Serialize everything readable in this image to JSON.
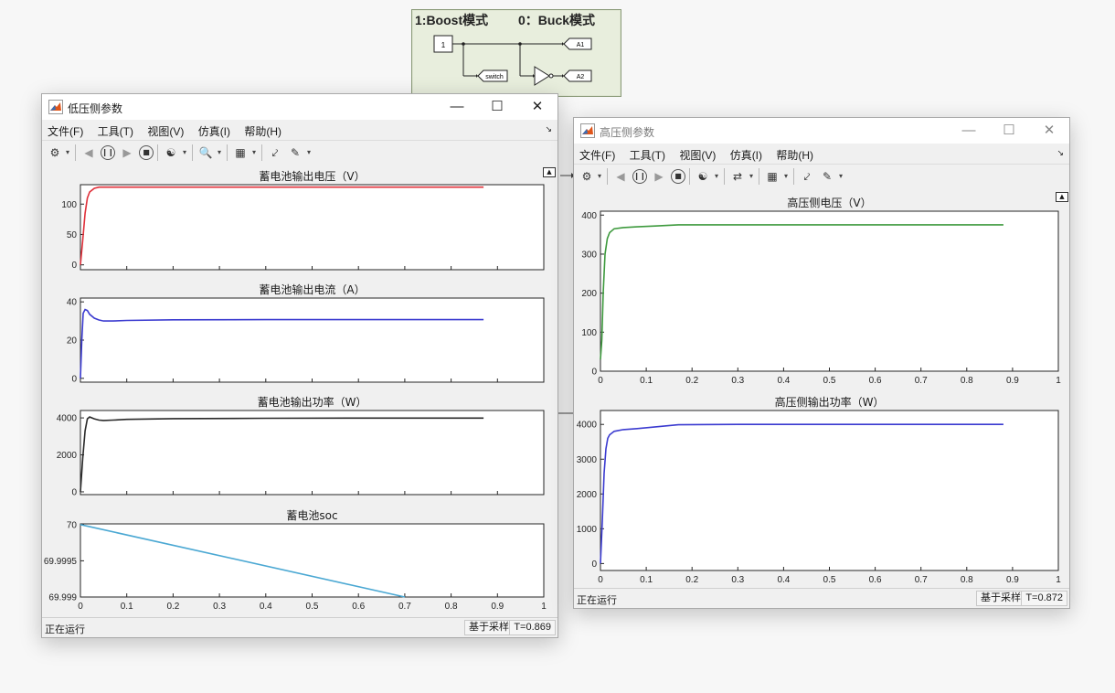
{
  "model": {
    "mode_boost": "1:Boost模式",
    "mode_buck": "0：Buck模式",
    "const_value": "1",
    "tag_switch": "switch",
    "tag_a1": "A1",
    "tag_a2": "A2"
  },
  "windows": [
    {
      "title": "低压侧参数",
      "menu": [
        "文件(F)",
        "工具(T)",
        "视图(V)",
        "仿真(I)",
        "帮助(H)"
      ],
      "status": "正在运行",
      "sampling": "基于采样",
      "time": "T=0.869"
    },
    {
      "title": "高压侧参数",
      "menu": [
        "文件(F)",
        "工具(T)",
        "视图(V)",
        "仿真(I)",
        "帮助(H)"
      ],
      "status": "正在运行",
      "sampling": "基于采样",
      "time": "T=0.872"
    }
  ],
  "chart_data": [
    {
      "type": "line",
      "title": "蓄电池输出电压（V）",
      "xlim": [
        0,
        0.87
      ],
      "ylim": [
        -8,
        132
      ],
      "yticks": [
        0,
        50,
        100
      ],
      "color": "#e0303a",
      "x": [
        0,
        0.005,
        0.01,
        0.015,
        0.02,
        0.03,
        0.04,
        0.06,
        0.1,
        0.3,
        0.5,
        0.7,
        0.87
      ],
      "y": [
        0,
        40,
        85,
        110,
        120,
        126,
        128,
        128,
        128,
        128,
        128,
        128,
        128
      ]
    },
    {
      "type": "line",
      "title": "蓄电池输出电流（A）",
      "xlim": [
        0,
        0.87
      ],
      "ylim": [
        -2,
        42
      ],
      "yticks": [
        0,
        20,
        40
      ],
      "color": "#3b3bd0",
      "x": [
        0,
        0.003,
        0.006,
        0.01,
        0.015,
        0.02,
        0.03,
        0.04,
        0.05,
        0.07,
        0.1,
        0.2,
        0.4,
        0.6,
        0.87
      ],
      "y": [
        0,
        20,
        34,
        36,
        35.5,
        33.5,
        31.5,
        30.5,
        30,
        30,
        30.3,
        30.6,
        30.7,
        30.7,
        30.7
      ]
    },
    {
      "type": "line",
      "title": "蓄电池输出功率（W）",
      "xlim": [
        0,
        0.87
      ],
      "ylim": [
        -150,
        4400
      ],
      "yticks": [
        0,
        2000,
        4000
      ],
      "color": "#2a2a2a",
      "x": [
        0,
        0.005,
        0.01,
        0.015,
        0.02,
        0.03,
        0.04,
        0.05,
        0.07,
        0.1,
        0.2,
        0.4,
        0.6,
        0.87
      ],
      "y": [
        0,
        1800,
        3300,
        3950,
        4050,
        3950,
        3880,
        3860,
        3880,
        3920,
        3960,
        3980,
        3990,
        3990
      ]
    },
    {
      "type": "line",
      "title": "蓄电池soc",
      "xlim": [
        0,
        1
      ],
      "ylim": [
        69.999,
        70.00001
      ],
      "yticks": [
        69.999,
        69.9995,
        70
      ],
      "ytick_labels": [
        "69.999",
        "69.9995",
        "70"
      ],
      "xticks": [
        0,
        0.1,
        0.2,
        0.3,
        0.4,
        0.5,
        0.6,
        0.7,
        0.8,
        0.9,
        1
      ],
      "color": "#4ba8d3",
      "x": [
        0,
        0.7
      ],
      "y": [
        70,
        69.999
      ]
    },
    {
      "type": "line",
      "title": "高压侧电压（V）",
      "xlim": [
        0,
        1
      ],
      "ylim": [
        0,
        410
      ],
      "yticks": [
        0,
        100,
        200,
        300,
        400
      ],
      "xticks": [
        0,
        0.1,
        0.2,
        0.3,
        0.4,
        0.5,
        0.6,
        0.7,
        0.8,
        0.9,
        1
      ],
      "color": "#3e9a3e",
      "x": [
        0,
        0.003,
        0.006,
        0.01,
        0.015,
        0.02,
        0.03,
        0.05,
        0.08,
        0.12,
        0.17,
        0.3,
        0.5,
        0.7,
        0.88
      ],
      "y": [
        30,
        80,
        200,
        300,
        340,
        355,
        365,
        368,
        370,
        372,
        375,
        375,
        375,
        375,
        375
      ]
    },
    {
      "type": "line",
      "title": "高压侧输出功率（W）",
      "xlim": [
        0,
        1
      ],
      "ylim": [
        -200,
        4400
      ],
      "yticks": [
        0,
        1000,
        2000,
        3000,
        4000
      ],
      "xticks": [
        0,
        0.1,
        0.2,
        0.3,
        0.4,
        0.5,
        0.6,
        0.7,
        0.8,
        0.9,
        1
      ],
      "color": "#3b3bd0",
      "x": [
        0,
        0.004,
        0.008,
        0.012,
        0.016,
        0.02,
        0.03,
        0.05,
        0.08,
        0.12,
        0.17,
        0.3,
        0.5,
        0.7,
        0.88
      ],
      "y": [
        0,
        1200,
        2600,
        3300,
        3600,
        3700,
        3800,
        3850,
        3880,
        3930,
        3990,
        4000,
        4000,
        4000,
        4000
      ]
    }
  ]
}
